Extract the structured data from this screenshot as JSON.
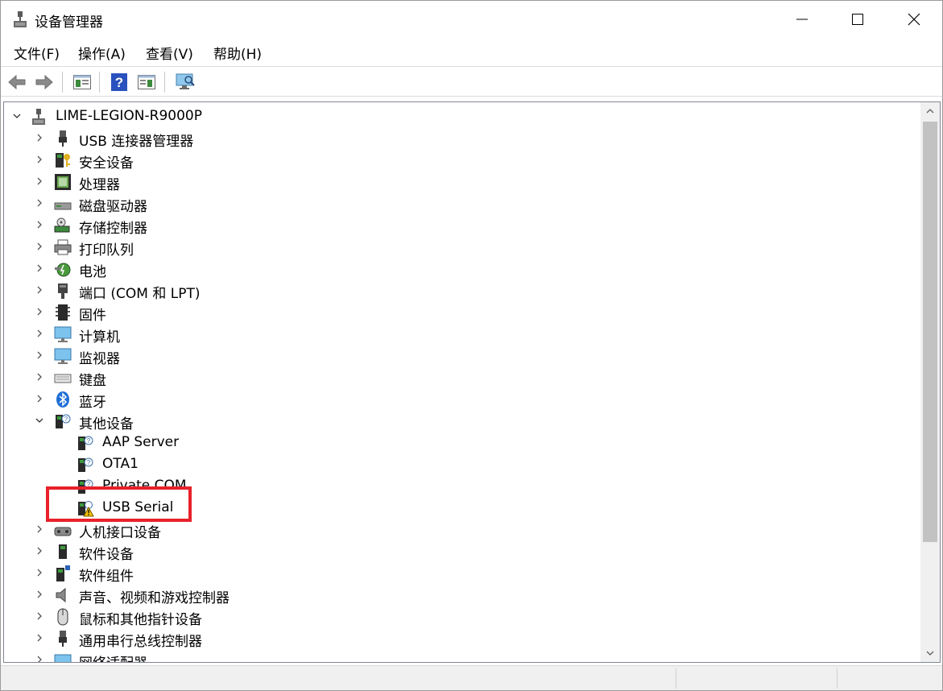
{
  "window": {
    "title": "设备管理器"
  },
  "menu": [
    "文件(F)",
    "操作(A)",
    "查看(V)",
    "帮助(H)"
  ],
  "toolbar": [
    "back-icon",
    "forward-icon",
    "properties-icon",
    "help-icon",
    "update-driver-icon",
    "scan-hardware-icon"
  ],
  "tree": {
    "root": "LIME-LEGION-R9000P",
    "categories": [
      {
        "label": "USB 连接器管理器",
        "icon": "usb-connector-icon"
      },
      {
        "label": "安全设备",
        "icon": "security-device-icon"
      },
      {
        "label": "处理器",
        "icon": "processor-icon"
      },
      {
        "label": "磁盘驱动器",
        "icon": "disk-drive-icon"
      },
      {
        "label": "存储控制器",
        "icon": "storage-controller-icon"
      },
      {
        "label": "打印队列",
        "icon": "printer-icon"
      },
      {
        "label": "电池",
        "icon": "battery-icon"
      },
      {
        "label": "端口 (COM 和 LPT)",
        "icon": "port-icon"
      },
      {
        "label": "固件",
        "icon": "firmware-icon"
      },
      {
        "label": "计算机",
        "icon": "computer-icon"
      },
      {
        "label": "监视器",
        "icon": "monitor-icon"
      },
      {
        "label": "键盘",
        "icon": "keyboard-icon"
      },
      {
        "label": "蓝牙",
        "icon": "bluetooth-icon"
      },
      {
        "label": "其他设备",
        "icon": "other-device-icon",
        "expanded": true
      }
    ],
    "other_devices": [
      {
        "label": "AAP Server",
        "icon": "unknown-device-icon"
      },
      {
        "label": "OTA1",
        "icon": "unknown-device-icon"
      },
      {
        "label": "Private COM",
        "icon": "unknown-device-icon"
      },
      {
        "label": "USB Serial",
        "icon": "warning-device-icon"
      }
    ],
    "categories_after": [
      {
        "label": "人机接口设备",
        "icon": "hid-icon"
      },
      {
        "label": "软件设备",
        "icon": "software-device-icon"
      },
      {
        "label": "软件组件",
        "icon": "software-component-icon"
      },
      {
        "label": "声音、视频和游戏控制器",
        "icon": "audio-icon"
      },
      {
        "label": "鼠标和其他指针设备",
        "icon": "mouse-icon"
      },
      {
        "label": "通用串行总线控制器",
        "icon": "usb-controller-icon"
      },
      {
        "label": "网络适配器",
        "icon": "network-adapter-icon"
      }
    ]
  },
  "colors": {
    "highlight": "#e8212b",
    "scroll_thumb": "#c2c2c2"
  }
}
